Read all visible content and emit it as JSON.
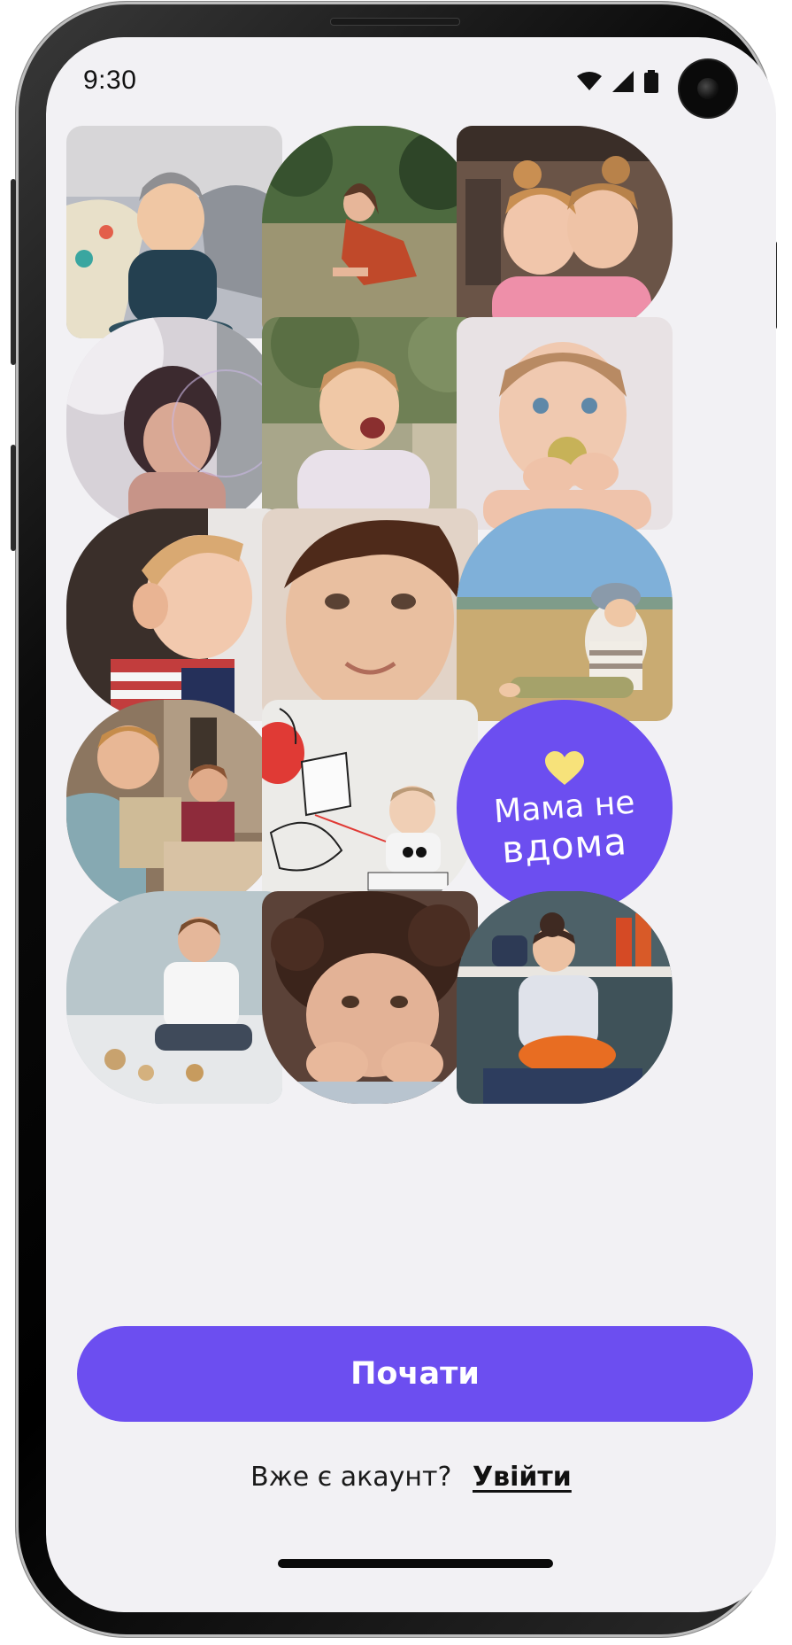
{
  "status_bar": {
    "time": "9:30",
    "icons": [
      "wifi-icon",
      "cellular-signal-icon",
      "battery-icon"
    ]
  },
  "photo_grid": {
    "tiles": [
      {
        "name": "photo-toddler-on-bed",
        "description_icon": "photo"
      },
      {
        "name": "photo-girl-in-grass",
        "description_icon": "photo"
      },
      {
        "name": "photo-two-girls-hugging",
        "description_icon": "photo"
      },
      {
        "name": "photo-girl-curly-hair",
        "description_icon": "photo"
      },
      {
        "name": "photo-baby-laughing",
        "description_icon": "photo"
      },
      {
        "name": "photo-baby-eating",
        "description_icon": "photo"
      },
      {
        "name": "photo-toddler-profile",
        "description_icon": "photo"
      },
      {
        "name": "photo-boy-smiling",
        "description_icon": "photo"
      },
      {
        "name": "photo-baby-on-beach",
        "description_icon": "photo"
      },
      {
        "name": "photo-kids-drawing",
        "description_icon": "photo"
      },
      {
        "name": "photo-baby-panda-shirt",
        "description_icon": "photo"
      },
      {
        "name": "photo-boy-playing-floor",
        "description_icon": "photo"
      },
      {
        "name": "photo-curly-toddler",
        "description_icon": "photo"
      },
      {
        "name": "photo-girl-cooking",
        "description_icon": "photo"
      }
    ]
  },
  "brand": {
    "line1": "Мама не",
    "line2": "вдома",
    "heart_color": "#f7e27a",
    "background_color": "#6c4ef0"
  },
  "primary_action": {
    "label": "Почати",
    "color": "#6c4ef0"
  },
  "account_prompt": {
    "text": "Вже є акаунт?",
    "link_label": "Увійти"
  }
}
